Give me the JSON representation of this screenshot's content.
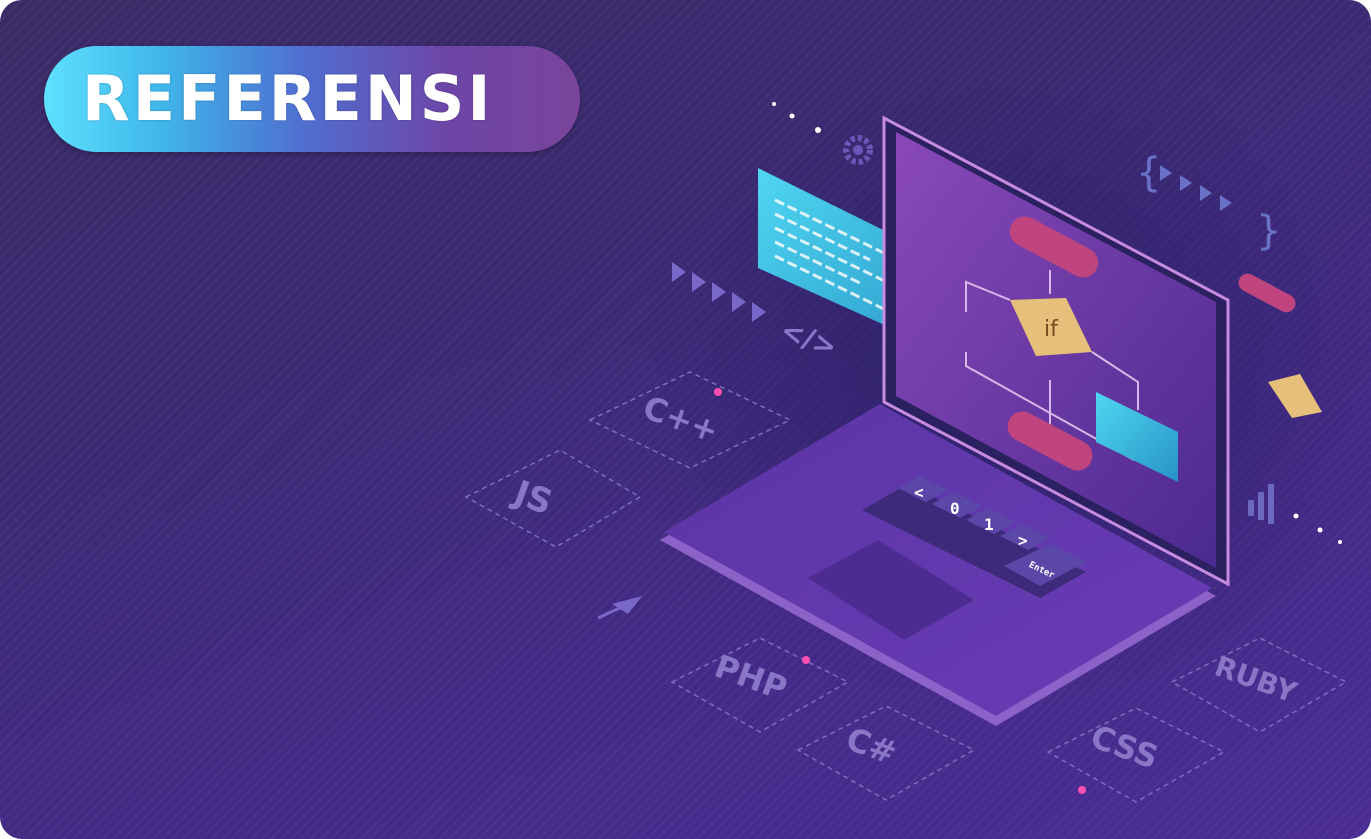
{
  "title": {
    "label": "REFERENSI"
  },
  "illustration": {
    "languages": [
      "C++",
      "JS",
      "PHP",
      "C#",
      "CSS",
      "RUBY"
    ],
    "code_tag": "</>",
    "flowchart_decision": "if",
    "keyboard_keys": [
      "<",
      "0",
      "1",
      ">"
    ],
    "enter_key": "Enter"
  },
  "colors": {
    "background": "#3d2b78",
    "pill_start": "#5ee0ff",
    "pill_end": "#7a449b",
    "screen_panel_cyan": "#33b8dc",
    "flow_pink": "#c0457e",
    "flow_diamond": "#e6c07a"
  }
}
